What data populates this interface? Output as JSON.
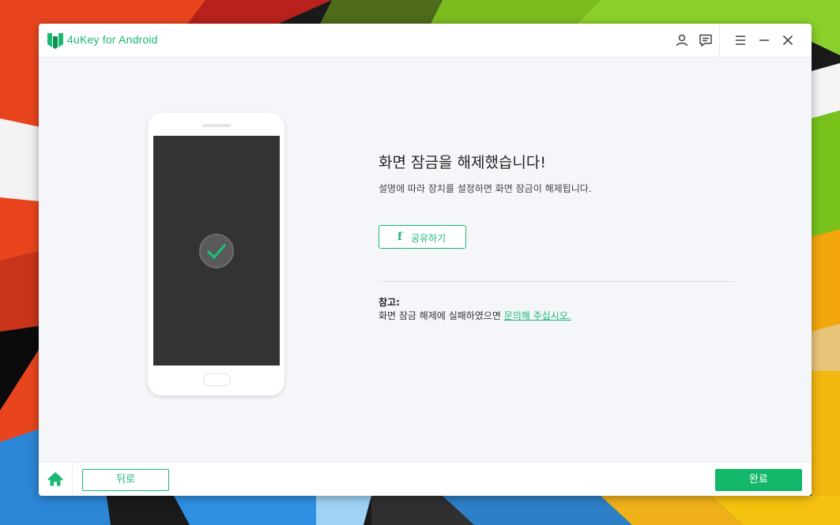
{
  "app": {
    "title": "4uKey for Android",
    "brand_color": "#1ab872"
  },
  "titlebar": {
    "icons": [
      "user-icon",
      "feedback-icon",
      "menu-icon",
      "minimize-icon",
      "close-icon"
    ]
  },
  "main": {
    "heading": "화면 잠금을 해제했습니다!",
    "description": "설명에 따라 장치를 설정하면 화면 잠금이 해제됩니다.",
    "share_button": {
      "icon": "facebook-icon",
      "label": "공유하기"
    },
    "note": {
      "title": "참고:",
      "text": "화면 잠금 해제에 실패하였으면 ",
      "link": "문의해 주십시오."
    }
  },
  "footer": {
    "home_icon": "home-icon",
    "back_label": "뒤로",
    "done_label": "완료"
  }
}
